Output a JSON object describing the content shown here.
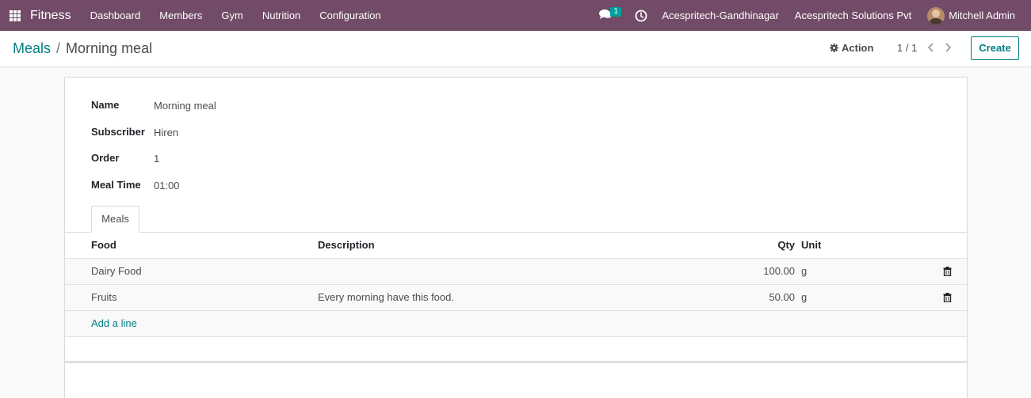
{
  "navbar": {
    "app_name": "Fitness",
    "menu": [
      "Dashboard",
      "Members",
      "Gym",
      "Nutrition",
      "Configuration"
    ],
    "chat_count": "1",
    "company_1": "Acespritech-Gandhinagar",
    "company_2": "Acespritech Solutions Pvt",
    "user_name": "Mitchell Admin",
    "color": "#714b67"
  },
  "control_panel": {
    "breadcrumb_parent": "Meals",
    "breadcrumb_sep": "/",
    "breadcrumb_current": "Morning meal",
    "action_label": "Action",
    "pager": "1 / 1",
    "create_label": "Create"
  },
  "form": {
    "fields": [
      {
        "label": "Name",
        "value": "Morning meal"
      },
      {
        "label": "Subscriber",
        "value": "Hiren"
      },
      {
        "label": "Order",
        "value": "1"
      },
      {
        "label": "Meal Time",
        "value": "01:00"
      }
    ],
    "tab_label": "Meals",
    "table": {
      "headers": {
        "food": "Food",
        "description": "Description",
        "qty": "Qty",
        "unit": "Unit"
      },
      "rows": [
        {
          "food": "Dairy Food",
          "description": "",
          "qty": "100.00",
          "unit": "g"
        },
        {
          "food": "Fruits",
          "description": "Every morning have this food.",
          "qty": "50.00",
          "unit": "g"
        }
      ],
      "add_line": "Add a line"
    }
  },
  "icons": [
    "apps-grid-icon",
    "chat-icon",
    "clock-icon",
    "gear-icon",
    "chevron-left-icon",
    "chevron-right-icon",
    "trash-icon"
  ],
  "accent_color": "#017e84"
}
